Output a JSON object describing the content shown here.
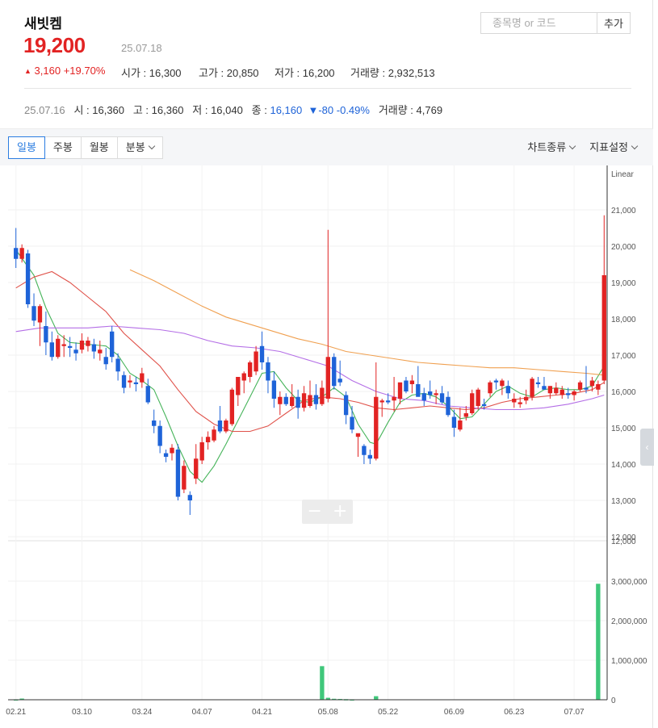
{
  "stock": {
    "name": "새빗켐",
    "price": "19,200",
    "date": "25.07.18",
    "change": "3,160",
    "change_pct": "+19.70%",
    "change_arrow": "▲",
    "open_label": "시가 : ",
    "open": "16,300",
    "high_label": "고가 : ",
    "high": "20,850",
    "low_label": "저가 : ",
    "low": "16,200",
    "volume_label": "거래량 : ",
    "volume": "2,932,513"
  },
  "search": {
    "placeholder": "종목명 or 코드",
    "add_label": "추가"
  },
  "prev_day": {
    "date": "25.07.16",
    "open_label": "시 : ",
    "open": "16,360",
    "high_label": "고 : ",
    "high": "16,360",
    "low_label": "저 : ",
    "low": "16,040",
    "close_label": "종 : ",
    "close": "16,160",
    "change_arrow": "▼",
    "change": "-80",
    "change_pct": "-0.49%",
    "volume_label": "거래량 : ",
    "volume": "4,769"
  },
  "toolbar": {
    "tabs": [
      "일봉",
      "주봉",
      "월봉",
      "분봉"
    ],
    "active_tab": "일봉",
    "chart_type": "차트종류",
    "indicator_settings": "지표설정"
  },
  "colors": {
    "up": "#e22323",
    "down": "#1e63d8",
    "volume": "#3fc77a",
    "ma5": "#46b45a",
    "ma20": "#e0524a",
    "ma60": "#b46ee6",
    "ma120": "#f0a050",
    "accent": "#2b7de1"
  },
  "chart_data": {
    "type": "candlestick",
    "scale_label": "Linear",
    "price_ticks": [
      "21,000",
      "20,000",
      "19,000",
      "18,000",
      "17,000",
      "16,000",
      "15,000",
      "14,000",
      "13,000",
      "12,000"
    ],
    "volume_ticks": [
      "12,000",
      "3,000,000",
      "2,000,000",
      "1,000,000",
      "0"
    ],
    "x_ticks": [
      "02.21",
      "03.10",
      "03.24",
      "04.07",
      "04.21",
      "05.08",
      "05.22",
      "06.09",
      "06.23",
      "07.07"
    ],
    "ylim": [
      12000,
      21400
    ],
    "candles": [
      [
        19950,
        20500,
        19400,
        19650
      ],
      [
        19650,
        20050,
        19550,
        19950
      ],
      [
        19800,
        19900,
        18300,
        18400
      ],
      [
        18350,
        18700,
        17800,
        17950
      ],
      [
        17900,
        18400,
        17250,
        18350
      ],
      [
        17800,
        18200,
        17000,
        17350
      ],
      [
        17350,
        17650,
        16850,
        16950
      ],
      [
        16950,
        17550,
        16900,
        17450
      ],
      [
        17250,
        17550,
        16950,
        17300
      ],
      [
        17250,
        17500,
        16950,
        17200
      ],
      [
        17150,
        17350,
        16850,
        17050
      ],
      [
        17150,
        17600,
        17050,
        17400
      ],
      [
        17250,
        17500,
        17100,
        17400
      ],
      [
        17300,
        17450,
        16900,
        17100
      ],
      [
        17050,
        17400,
        16850,
        17150
      ],
      [
        16950,
        17200,
        16600,
        16750
      ],
      [
        17650,
        17800,
        16800,
        16950
      ],
      [
        16900,
        17050,
        16300,
        16550
      ],
      [
        16450,
        16550,
        15950,
        16100
      ],
      [
        16250,
        16450,
        16100,
        16300
      ],
      [
        16250,
        16400,
        16000,
        16200
      ],
      [
        16250,
        16650,
        16100,
        16500
      ],
      [
        16150,
        16350,
        15650,
        15700
      ],
      [
        15200,
        15500,
        14850,
        15050
      ],
      [
        15050,
        15200,
        14300,
        14500
      ],
      [
        14300,
        14400,
        14050,
        14200
      ],
      [
        14300,
        14550,
        14100,
        14450
      ],
      [
        14400,
        14550,
        13000,
        13100
      ],
      [
        13300,
        14100,
        13200,
        13950
      ],
      [
        13150,
        13250,
        12600,
        13000
      ],
      [
        13600,
        14550,
        13450,
        14150
      ],
      [
        14100,
        14750,
        14000,
        14600
      ],
      [
        14600,
        14900,
        14400,
        14750
      ],
      [
        14650,
        15050,
        14600,
        14950
      ],
      [
        15200,
        15600,
        14850,
        14900
      ],
      [
        14900,
        15250,
        14850,
        15200
      ],
      [
        15100,
        16100,
        15050,
        16050
      ],
      [
        15900,
        16350,
        15600,
        16400
      ],
      [
        16300,
        16550,
        15950,
        16500
      ],
      [
        16400,
        16850,
        16250,
        16800
      ],
      [
        16550,
        17250,
        16450,
        17100
      ],
      [
        17250,
        17650,
        16600,
        16800
      ],
      [
        16800,
        16950,
        15950,
        16300
      ],
      [
        16300,
        16550,
        15550,
        15800
      ],
      [
        15650,
        16000,
        15350,
        15850
      ],
      [
        15850,
        15950,
        15600,
        15650
      ],
      [
        15600,
        16200,
        15550,
        15850
      ],
      [
        15850,
        16050,
        15250,
        15550
      ],
      [
        15550,
        16150,
        15450,
        15950
      ],
      [
        15600,
        16300,
        15550,
        15900
      ],
      [
        15900,
        16200,
        15500,
        15650
      ],
      [
        15650,
        16300,
        15600,
        16100
      ],
      [
        15800,
        20450,
        15700,
        16950
      ],
      [
        16950,
        17050,
        16050,
        16150
      ],
      [
        16350,
        16850,
        16150,
        16250
      ],
      [
        15900,
        16000,
        15100,
        15350
      ],
      [
        15300,
        15600,
        14850,
        14950
      ],
      [
        14750,
        14800,
        14200,
        14850
      ],
      [
        14500,
        14550,
        14000,
        14250
      ],
      [
        14250,
        14400,
        14000,
        14150
      ],
      [
        14150,
        16800,
        14100,
        15850
      ],
      [
        15700,
        15800,
        15300,
        15750
      ],
      [
        15750,
        15950,
        15650,
        15700
      ],
      [
        15750,
        16400,
        15450,
        15850
      ],
      [
        15800,
        16050,
        15650,
        16250
      ],
      [
        16300,
        16400,
        15950,
        16000
      ],
      [
        16200,
        16450,
        15950,
        16300
      ],
      [
        16200,
        16700,
        16050,
        15850
      ],
      [
        15950,
        16100,
        15600,
        15750
      ],
      [
        16000,
        16300,
        15800,
        15900
      ],
      [
        15900,
        16050,
        15650,
        15950
      ],
      [
        15950,
        16150,
        15650,
        15700
      ],
      [
        15850,
        16000,
        15300,
        15350
      ],
      [
        15300,
        15500,
        14750,
        15000
      ],
      [
        14950,
        15550,
        14900,
        15200
      ],
      [
        15300,
        15600,
        15200,
        15400
      ],
      [
        15400,
        16050,
        15350,
        15950
      ],
      [
        15600,
        16100,
        15500,
        16050
      ],
      [
        15650,
        15800,
        15500,
        15600
      ],
      [
        15950,
        16300,
        15850,
        16250
      ],
      [
        16300,
        16350,
        16050,
        16250
      ],
      [
        16150,
        16350,
        15900,
        16300
      ],
      [
        16150,
        16300,
        15800,
        15950
      ],
      [
        15700,
        15950,
        15550,
        15800
      ],
      [
        15650,
        15850,
        15550,
        15700
      ],
      [
        15750,
        16050,
        15650,
        15850
      ],
      [
        15850,
        16400,
        15750,
        16350
      ],
      [
        16250,
        16400,
        16100,
        16200
      ],
      [
        16150,
        16400,
        16050,
        16050
      ],
      [
        15950,
        16150,
        15800,
        16150
      ],
      [
        15950,
        16250,
        15900,
        16100
      ],
      [
        15900,
        16150,
        15800,
        16050
      ],
      [
        15950,
        16100,
        15800,
        15900
      ],
      [
        15900,
        16050,
        15750,
        16000
      ],
      [
        16050,
        16300,
        16000,
        16250
      ],
      [
        16100,
        16700,
        15950,
        16050
      ],
      [
        16150,
        16400,
        16000,
        16300
      ],
      [
        16050,
        16300,
        15900,
        16200
      ],
      [
        16300,
        20850,
        16200,
        19200
      ]
    ],
    "volume": [
      10000,
      30000,
      0,
      0,
      0,
      0,
      0,
      0,
      0,
      0,
      0,
      0,
      0,
      0,
      0,
      0,
      0,
      0,
      0,
      0,
      0,
      0,
      0,
      0,
      0,
      0,
      0,
      0,
      0,
      0,
      0,
      0,
      0,
      0,
      0,
      0,
      0,
      0,
      0,
      0,
      0,
      0,
      0,
      0,
      0,
      0,
      0,
      0,
      0,
      0,
      0,
      850000,
      50000,
      25000,
      20000,
      15000,
      10000,
      0,
      0,
      0,
      90000,
      0,
      0,
      0,
      0,
      0,
      0,
      0,
      0,
      0,
      0,
      0,
      0,
      0,
      0,
      0,
      0,
      0,
      0,
      0,
      0,
      0,
      0,
      0,
      0,
      0,
      0,
      0,
      0,
      0,
      0,
      0,
      0,
      0,
      0,
      0,
      0,
      2932513
    ],
    "moving_averages": [
      {
        "name": "ma5",
        "points": [
          [
            0,
            19900
          ],
          [
            3,
            19200
          ],
          [
            5,
            18300
          ],
          [
            7,
            17600
          ],
          [
            9,
            17350
          ],
          [
            12,
            17300
          ],
          [
            15,
            17250
          ],
          [
            17,
            17000
          ],
          [
            19,
            16500
          ],
          [
            21,
            16300
          ],
          [
            23,
            16050
          ],
          [
            25,
            15300
          ],
          [
            27,
            14500
          ],
          [
            29,
            13800
          ],
          [
            31,
            13500
          ],
          [
            33,
            13950
          ],
          [
            35,
            14550
          ],
          [
            37,
            15200
          ],
          [
            39,
            15850
          ],
          [
            41,
            16500
          ],
          [
            43,
            16550
          ],
          [
            45,
            16100
          ],
          [
            47,
            15750
          ],
          [
            49,
            15700
          ],
          [
            51,
            15850
          ],
          [
            53,
            16100
          ],
          [
            55,
            15850
          ],
          [
            57,
            15100
          ],
          [
            59,
            14600
          ],
          [
            60,
            14550
          ],
          [
            62,
            15150
          ],
          [
            64,
            15700
          ],
          [
            66,
            15900
          ],
          [
            68,
            15950
          ],
          [
            70,
            15850
          ],
          [
            72,
            15600
          ],
          [
            74,
            15250
          ],
          [
            76,
            15300
          ],
          [
            78,
            15650
          ],
          [
            80,
            16000
          ],
          [
            82,
            16150
          ],
          [
            84,
            15950
          ],
          [
            86,
            15850
          ],
          [
            88,
            16050
          ],
          [
            90,
            16100
          ],
          [
            92,
            16050
          ],
          [
            94,
            16050
          ],
          [
            96,
            16150
          ],
          [
            98,
            16700
          ]
        ]
      },
      {
        "name": "ma20",
        "points": [
          [
            0,
            18850
          ],
          [
            3,
            19150
          ],
          [
            6,
            19300
          ],
          [
            9,
            19000
          ],
          [
            12,
            18600
          ],
          [
            15,
            18200
          ],
          [
            18,
            17600
          ],
          [
            21,
            17150
          ],
          [
            24,
            16700
          ],
          [
            27,
            16050
          ],
          [
            30,
            15450
          ],
          [
            33,
            15100
          ],
          [
            36,
            14900
          ],
          [
            39,
            14900
          ],
          [
            42,
            15050
          ],
          [
            45,
            15400
          ],
          [
            48,
            15750
          ],
          [
            51,
            15850
          ],
          [
            54,
            15800
          ],
          [
            57,
            15700
          ],
          [
            60,
            15550
          ],
          [
            63,
            15500
          ],
          [
            66,
            15550
          ],
          [
            69,
            15600
          ],
          [
            72,
            15550
          ],
          [
            75,
            15500
          ],
          [
            78,
            15550
          ],
          [
            81,
            15700
          ],
          [
            84,
            15800
          ],
          [
            87,
            15850
          ],
          [
            90,
            15900
          ],
          [
            93,
            15950
          ],
          [
            96,
            16050
          ],
          [
            98,
            16250
          ]
        ]
      },
      {
        "name": "ma60",
        "points": [
          [
            0,
            17650
          ],
          [
            4,
            17750
          ],
          [
            8,
            17750
          ],
          [
            12,
            17750
          ],
          [
            16,
            17800
          ],
          [
            20,
            17750
          ],
          [
            24,
            17700
          ],
          [
            28,
            17600
          ],
          [
            32,
            17400
          ],
          [
            36,
            17250
          ],
          [
            40,
            17200
          ],
          [
            44,
            17100
          ],
          [
            48,
            16900
          ],
          [
            52,
            16700
          ],
          [
            56,
            16300
          ],
          [
            60,
            16000
          ],
          [
            64,
            15800
          ],
          [
            68,
            15750
          ],
          [
            72,
            15600
          ],
          [
            76,
            15550
          ],
          [
            80,
            15500
          ],
          [
            84,
            15500
          ],
          [
            88,
            15550
          ],
          [
            92,
            15650
          ],
          [
            96,
            15800
          ],
          [
            98,
            15900
          ]
        ]
      },
      {
        "name": "ma120",
        "points": [
          [
            19,
            19350
          ],
          [
            23,
            19050
          ],
          [
            27,
            18700
          ],
          [
            31,
            18350
          ],
          [
            35,
            18050
          ],
          [
            39,
            17850
          ],
          [
            43,
            17650
          ],
          [
            47,
            17450
          ],
          [
            51,
            17300
          ],
          [
            55,
            17100
          ],
          [
            59,
            17000
          ],
          [
            63,
            16900
          ],
          [
            67,
            16800
          ],
          [
            71,
            16750
          ],
          [
            75,
            16700
          ],
          [
            79,
            16650
          ],
          [
            83,
            16650
          ],
          [
            87,
            16600
          ],
          [
            91,
            16550
          ],
          [
            95,
            16500
          ],
          [
            98,
            16450
          ]
        ]
      }
    ]
  }
}
